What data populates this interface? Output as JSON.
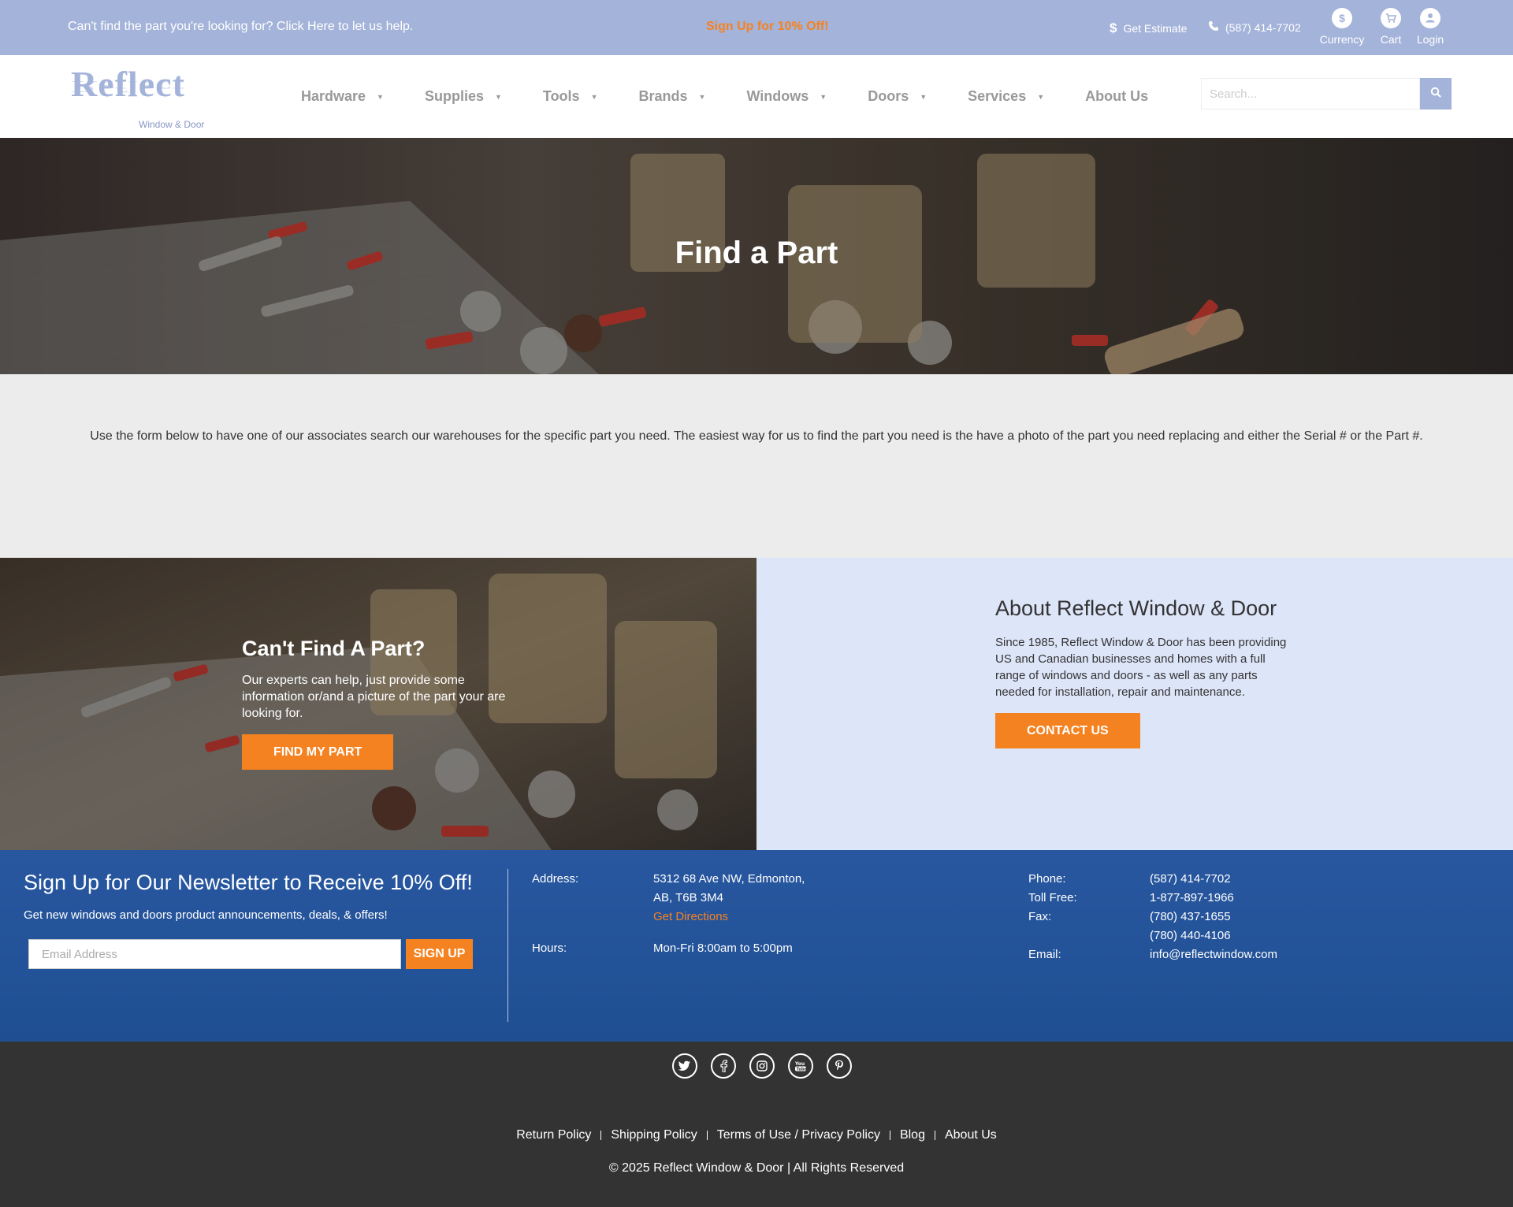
{
  "topbar": {
    "help_text": "Can't find the part you're looking for? Click Here to let us help.",
    "promo_text": "Sign Up for 10% Off!",
    "estimate_label": "Get Estimate",
    "phone": "(587) 414-7702",
    "currency_label": "Currency",
    "cart_label": "Cart",
    "login_label": "Login"
  },
  "header": {
    "logo_word": "Reflect",
    "logo_sub": "Window & Door",
    "nav": [
      {
        "label": "Hardware",
        "has_dropdown": true
      },
      {
        "label": "Supplies",
        "has_dropdown": true
      },
      {
        "label": "Tools",
        "has_dropdown": true
      },
      {
        "label": "Brands",
        "has_dropdown": true
      },
      {
        "label": "Windows",
        "has_dropdown": true
      },
      {
        "label": "Doors",
        "has_dropdown": true
      },
      {
        "label": "Services",
        "has_dropdown": true
      },
      {
        "label": "About Us",
        "has_dropdown": false
      }
    ],
    "search_placeholder": "Search..."
  },
  "hero": {
    "title": "Find a Part"
  },
  "intro": {
    "text": "Use the form below to have one of our associates search our warehouses for the specific part you need. The easiest way for us to find the part you need is the have a photo of the part you need replacing and either the Serial # or the Part #."
  },
  "cta_left": {
    "title": "Can't Find A Part?",
    "text": "Our experts can help, just provide some information or/and a picture of the part your are looking for.",
    "button": "FIND MY PART"
  },
  "cta_right": {
    "title": "About Reflect Window & Door",
    "text": "Since 1985, Reflect Window & Door has been providing US and Canadian businesses and homes with a full range of windows and doors - as well as any parts needed for installation, repair and maintenance.",
    "button": "CONTACT US"
  },
  "footer": {
    "newsletter_title": "Sign Up for Our Newsletter to Receive 10% Off!",
    "newsletter_text": "Get new windows and doors product announcements, deals, & offers!",
    "email_placeholder": "Email Address",
    "signup_label": "SIGN UP",
    "address_label": "Address:",
    "address_line1": "5312 68 Ave NW, Edmonton,",
    "address_line2": "AB, T6B 3M4",
    "directions_label": "Get Directions",
    "hours_label": "Hours:",
    "hours_value": "Mon-Fri 8:00am to 5:00pm",
    "phone_label": "Phone:",
    "phone_value": "(587) 414-7702",
    "tollfree_label": "Toll Free:",
    "tollfree_value": "1-877-897-1966",
    "fax_label": "Fax:",
    "fax_value1": "(780) 437-1655",
    "fax_value2": "(780) 440-4106",
    "email_label": "Email:",
    "email_value": "info@reflectwindow.com"
  },
  "bottom": {
    "social": [
      "twitter-icon",
      "facebook-icon",
      "instagram-icon",
      "youtube-icon",
      "pinterest-icon"
    ],
    "links": [
      "Return Policy",
      "Shipping Policy",
      "Terms of Use / Privacy Policy",
      "Blog",
      "About Us"
    ],
    "copyright": "© 2025 Reflect Window & Door | All Rights Reserved"
  },
  "colors": {
    "topbar_bg": "#a4b3d9",
    "accent_orange": "#f58220",
    "about_bg": "#dde5f8",
    "footer_blue": "#2857a0",
    "bottom_bg": "#333333"
  }
}
